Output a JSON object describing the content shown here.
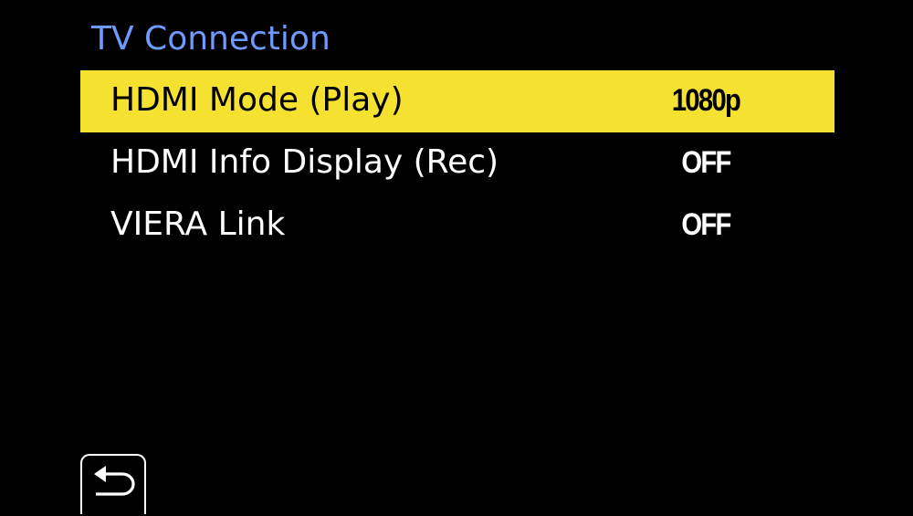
{
  "menu": {
    "title": "TV Connection",
    "items": [
      {
        "label": "HDMI Mode (Play)",
        "value": "1080p",
        "selected": true
      },
      {
        "label": "HDMI Info Display (Rec)",
        "value": "OFF",
        "selected": false
      },
      {
        "label": "VIERA Link",
        "value": "OFF",
        "selected": false
      }
    ]
  },
  "footer": {
    "back_icon": "return-arrow-icon"
  },
  "colors": {
    "background": "#000000",
    "title": "#6f9bff",
    "highlight": "#f5e130",
    "text": "#ffffff",
    "selected_text": "#000000"
  }
}
